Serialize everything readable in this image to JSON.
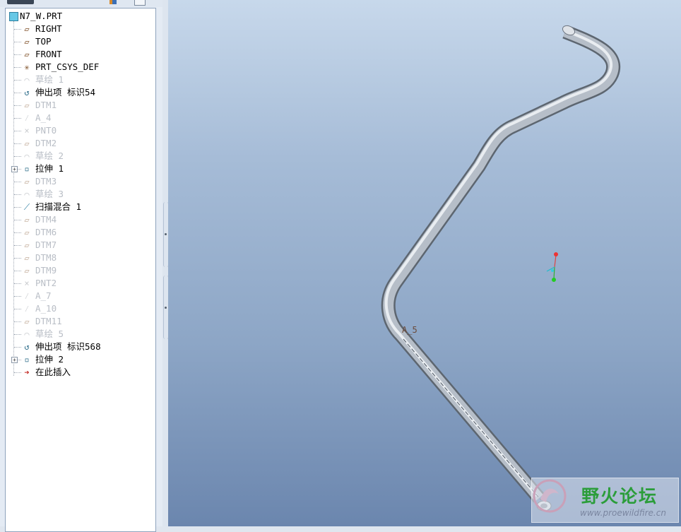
{
  "model_tree": {
    "root": "N7_W.PRT",
    "items": [
      {
        "label": "RIGHT",
        "icon": "datum-plane-icon",
        "suppressed": false,
        "expandable": false
      },
      {
        "label": "TOP",
        "icon": "datum-plane-icon",
        "suppressed": false,
        "expandable": false
      },
      {
        "label": "FRONT",
        "icon": "datum-plane-icon",
        "suppressed": false,
        "expandable": false
      },
      {
        "label": "PRT_CSYS_DEF",
        "icon": "csys-icon",
        "suppressed": false,
        "expandable": false
      },
      {
        "label": "草绘 1",
        "icon": "sketch-icon",
        "suppressed": true,
        "expandable": false
      },
      {
        "label": "伸出项 标识54",
        "icon": "protrusion-icon",
        "suppressed": false,
        "expandable": false
      },
      {
        "label": "DTM1",
        "icon": "datum-plane-icon",
        "suppressed": true,
        "expandable": false
      },
      {
        "label": "A_4",
        "icon": "datum-axis-icon",
        "suppressed": true,
        "expandable": false
      },
      {
        "label": "PNT0",
        "icon": "datum-point-icon",
        "suppressed": true,
        "expandable": false
      },
      {
        "label": "DTM2",
        "icon": "datum-plane-icon",
        "suppressed": true,
        "expandable": false
      },
      {
        "label": "草绘 2",
        "icon": "sketch-icon",
        "suppressed": true,
        "expandable": false
      },
      {
        "label": "拉伸 1",
        "icon": "extrude-icon",
        "suppressed": false,
        "expandable": true
      },
      {
        "label": "DTM3",
        "icon": "datum-plane-icon",
        "suppressed": true,
        "expandable": false
      },
      {
        "label": "草绘 3",
        "icon": "sketch-icon",
        "suppressed": true,
        "expandable": false
      },
      {
        "label": "扫描混合 1",
        "icon": "swept-blend-icon",
        "suppressed": false,
        "expandable": false
      },
      {
        "label": "DTM4",
        "icon": "datum-plane-icon",
        "suppressed": true,
        "expandable": false
      },
      {
        "label": "DTM6",
        "icon": "datum-plane-icon",
        "suppressed": true,
        "expandable": false
      },
      {
        "label": "DTM7",
        "icon": "datum-plane-icon",
        "suppressed": true,
        "expandable": false
      },
      {
        "label": "DTM8",
        "icon": "datum-plane-icon",
        "suppressed": true,
        "expandable": false
      },
      {
        "label": "DTM9",
        "icon": "datum-plane-icon",
        "suppressed": true,
        "expandable": false
      },
      {
        "label": "PNT2",
        "icon": "datum-point-icon",
        "suppressed": true,
        "expandable": false
      },
      {
        "label": "A_7",
        "icon": "datum-axis-icon",
        "suppressed": true,
        "expandable": false
      },
      {
        "label": "A_10",
        "icon": "datum-axis-icon",
        "suppressed": true,
        "expandable": false
      },
      {
        "label": "DTM11",
        "icon": "datum-plane-icon",
        "suppressed": true,
        "expandable": false
      },
      {
        "label": "草绘 5",
        "icon": "sketch-icon",
        "suppressed": true,
        "expandable": false
      },
      {
        "label": "伸出项 标识568",
        "icon": "protrusion-icon",
        "suppressed": false,
        "expandable": false
      },
      {
        "label": "拉伸 2",
        "icon": "extrude-icon",
        "suppressed": false,
        "expandable": true
      },
      {
        "label": "在此插入",
        "icon": "insert-arrow-icon",
        "suppressed": false,
        "expandable": false
      }
    ]
  },
  "viewport": {
    "axis_label": "A_5"
  },
  "watermark": {
    "title": "野火论坛",
    "url": "www.proewildfire.cn"
  },
  "colors": {
    "suppressed_text": "#b9bec6",
    "tree_bg": "#ffffff",
    "viewport_top": "#c7d8eb",
    "viewport_bottom": "#6b86ae",
    "watermark_green": "#2b9d3a"
  }
}
